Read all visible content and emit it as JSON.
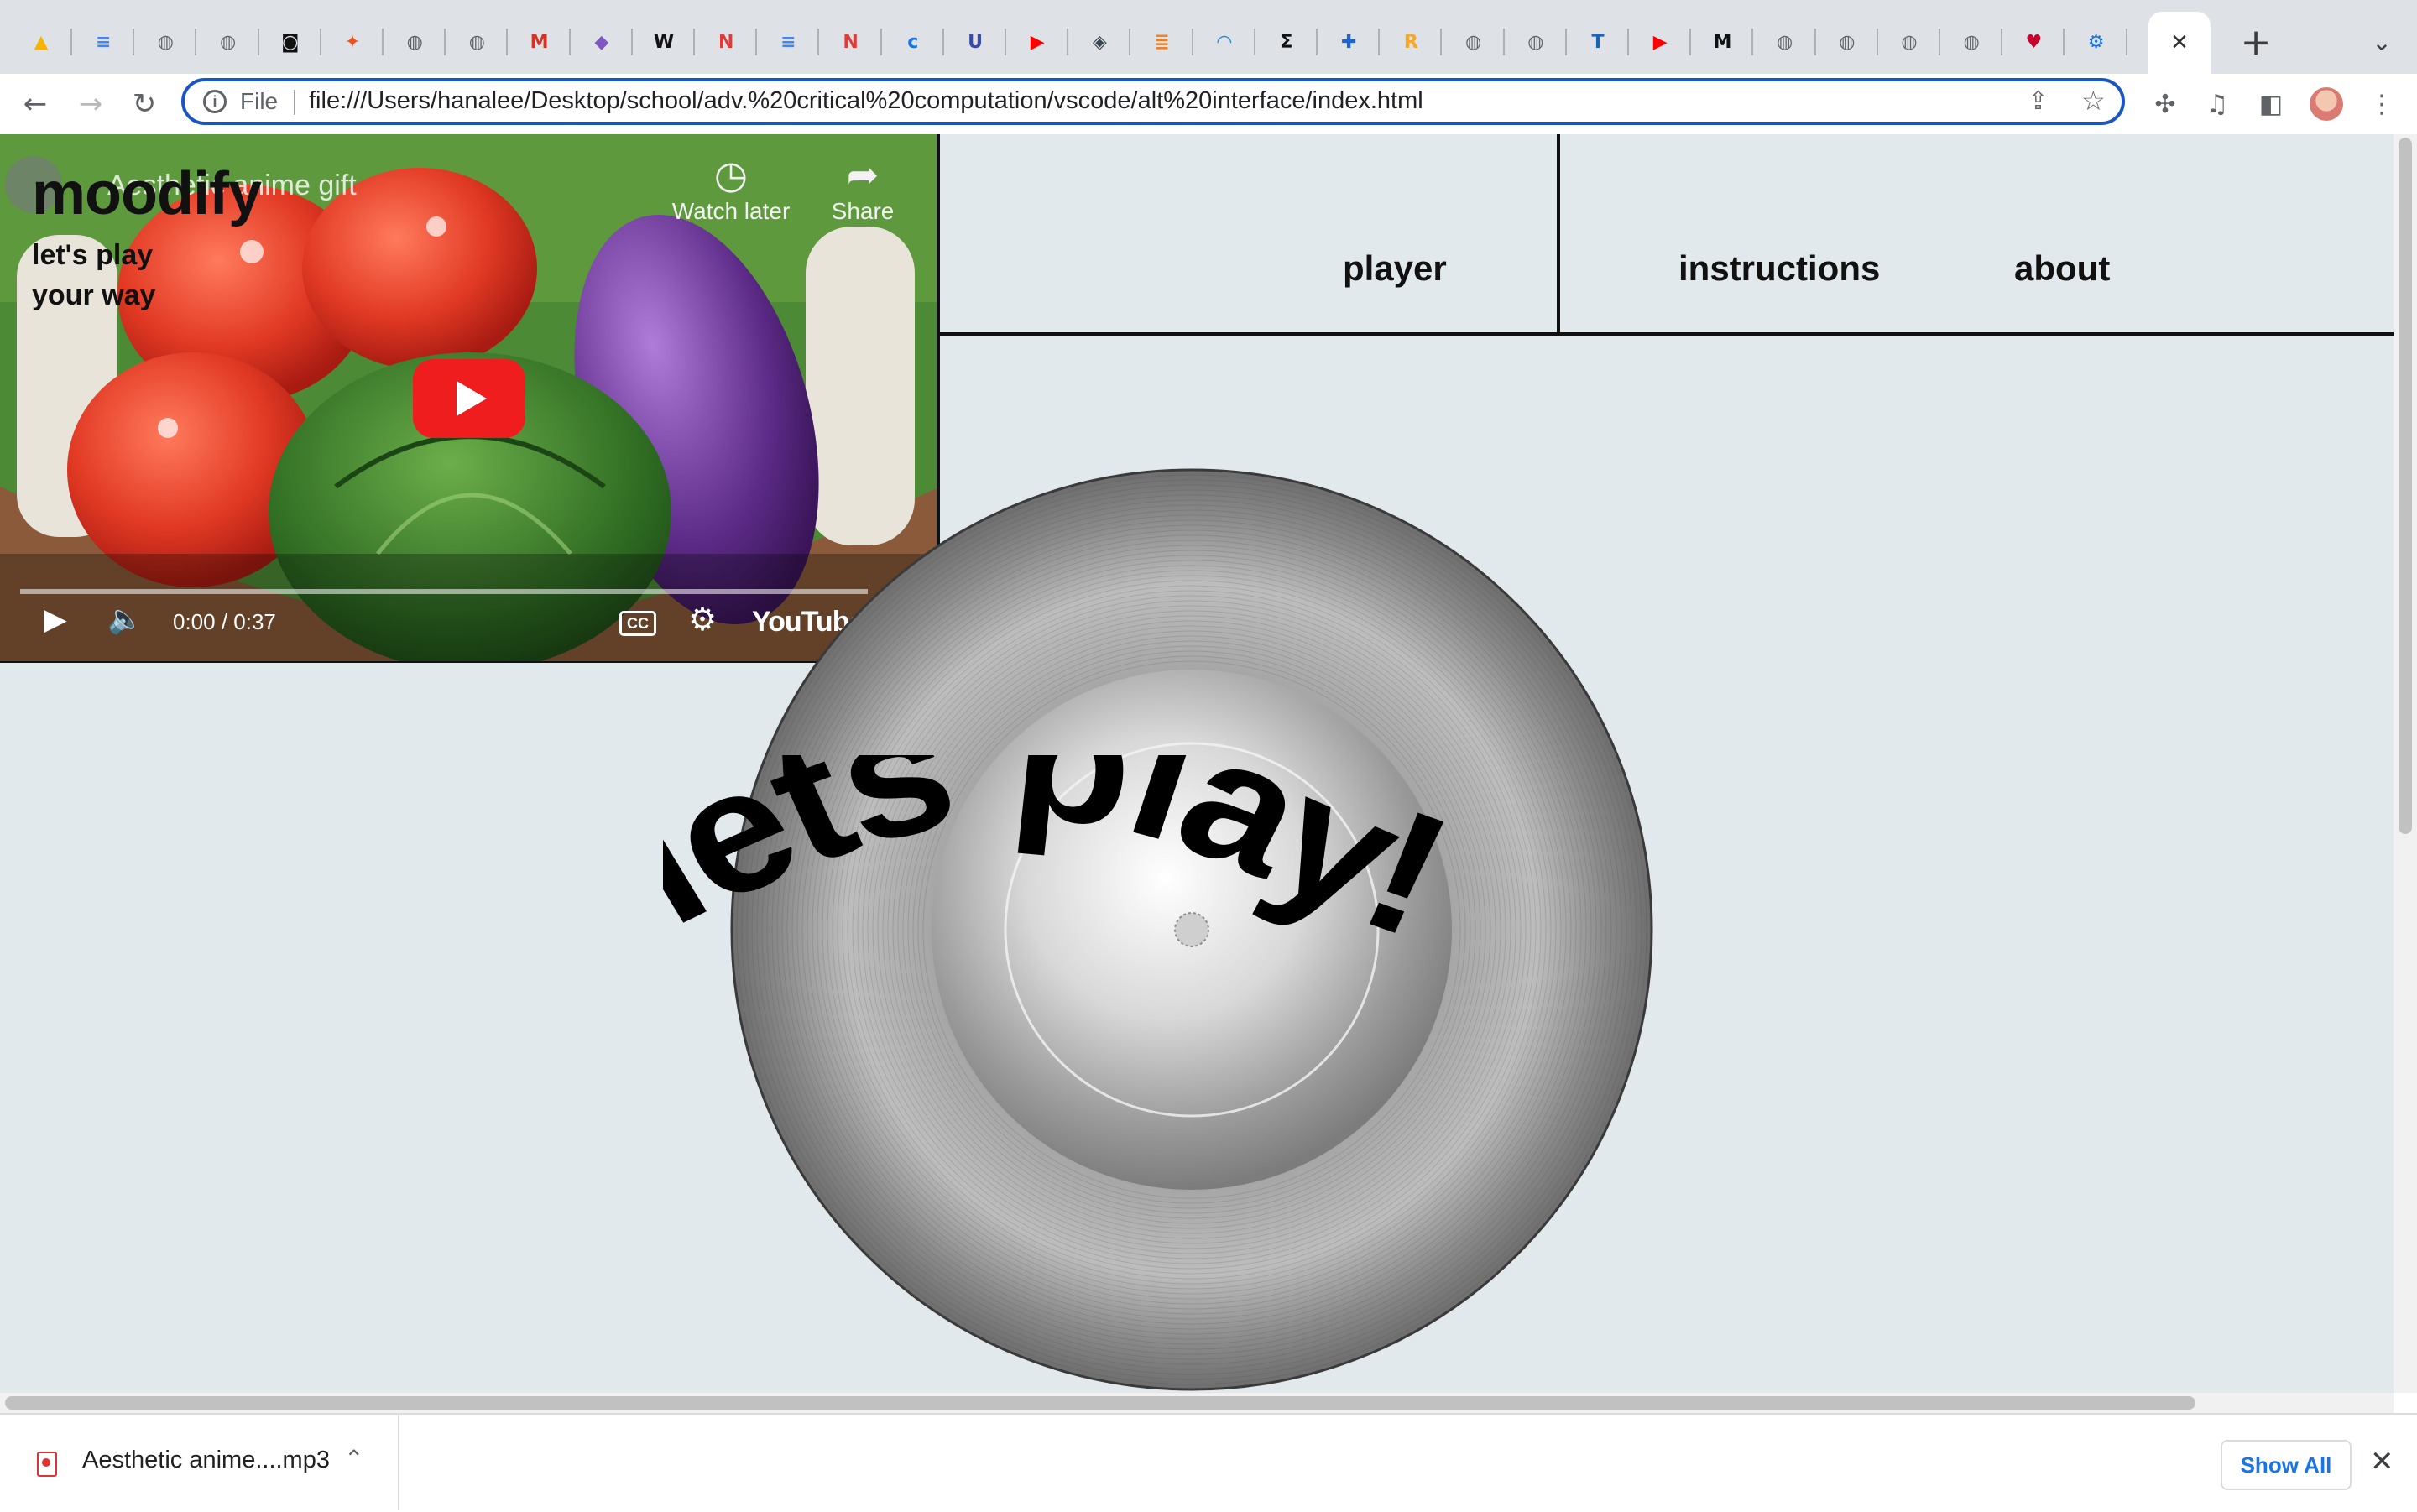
{
  "browser": {
    "tabs": [
      {
        "icon": "google-drive-icon",
        "color": "#f4b400",
        "glyph": "▲"
      },
      {
        "icon": "google-docs-icon",
        "color": "#4285f4",
        "glyph": "≡"
      },
      {
        "icon": "globe-icon",
        "color": "#5f6368",
        "glyph": "◍"
      },
      {
        "icon": "globe-icon",
        "color": "#5f6368",
        "glyph": "◍"
      },
      {
        "icon": "notion-like-icon",
        "color": "#111111",
        "glyph": "◙"
      },
      {
        "icon": "figma-icon",
        "color": "#f24e1e",
        "glyph": "✦"
      },
      {
        "icon": "globe-icon",
        "color": "#5f6368",
        "glyph": "◍"
      },
      {
        "icon": "globe-icon",
        "color": "#5f6368",
        "glyph": "◍"
      },
      {
        "icon": "gmail-icon",
        "color": "#d93025",
        "glyph": "M"
      },
      {
        "icon": "app-icon",
        "color": "#7e57c2",
        "glyph": "◆"
      },
      {
        "icon": "wix-icon",
        "color": "#111111",
        "glyph": "W"
      },
      {
        "icon": "n-icon",
        "color": "#e53935",
        "glyph": "N"
      },
      {
        "icon": "google-docs-icon",
        "color": "#4285f4",
        "glyph": "≡"
      },
      {
        "icon": "n-icon",
        "color": "#e53935",
        "glyph": "N"
      },
      {
        "icon": "c-icon",
        "color": "#1a73e8",
        "glyph": "c"
      },
      {
        "icon": "u-icon",
        "color": "#3949ab",
        "glyph": "U"
      },
      {
        "icon": "youtube-icon",
        "color": "#ff0000",
        "glyph": "▶"
      },
      {
        "icon": "layers-icon",
        "color": "#37474f",
        "glyph": "◈"
      },
      {
        "icon": "stack-icon",
        "color": "#f48024",
        "glyph": "≣"
      },
      {
        "icon": "arc-icon",
        "color": "#1e88e5",
        "glyph": "◠"
      },
      {
        "icon": "sigma-icon",
        "color": "#111111",
        "glyph": "Σ"
      },
      {
        "icon": "plus-icon",
        "color": "#1e63d6",
        "glyph": "✚"
      },
      {
        "icon": "r-icon",
        "color": "#f9a825",
        "glyph": "R"
      },
      {
        "icon": "globe-icon",
        "color": "#5f6368",
        "glyph": "◍"
      },
      {
        "icon": "globe-icon",
        "color": "#5f6368",
        "glyph": "◍"
      },
      {
        "icon": "tm-icon",
        "color": "#1565c0",
        "glyph": "T"
      },
      {
        "icon": "youtube-icon",
        "color": "#ff0000",
        "glyph": "▶"
      },
      {
        "icon": "m-icon",
        "color": "#111111",
        "glyph": "M"
      },
      {
        "icon": "globe-icon",
        "color": "#5f6368",
        "glyph": "◍"
      },
      {
        "icon": "globe-icon",
        "color": "#5f6368",
        "glyph": "◍"
      },
      {
        "icon": "globe-icon",
        "color": "#5f6368",
        "glyph": "◍"
      },
      {
        "icon": "globe-icon",
        "color": "#5f6368",
        "glyph": "◍"
      },
      {
        "icon": "iheart-icon",
        "color": "#c6002b",
        "glyph": "♥"
      },
      {
        "icon": "gear-icon",
        "color": "#1a73e8",
        "glyph": "⚙"
      }
    ],
    "address": {
      "scheme_label": "File",
      "url": "file:///Users/hanalee/Desktop/school/adv.%20critical%20computation/vscode/alt%20interface/index.html"
    }
  },
  "page": {
    "logo": "moodify",
    "tagline_line1": "let's play",
    "tagline_line2": "your way",
    "nav": [
      "player",
      "instructions",
      "about"
    ],
    "hero_text": "lets play!",
    "video": {
      "title": "Aesthetic anime gift",
      "watch_later": "Watch later",
      "share": "Share",
      "time": "0:00 / 0:37",
      "brand": "YouTube",
      "progress": 0
    }
  },
  "downloads": {
    "file_name": "Aesthetic anime....mp3",
    "show_all": "Show All"
  },
  "colors": {
    "page_bg": "#e2e9ec",
    "accent": "#1a56c2",
    "youtube_red": "#ef1d1d"
  }
}
